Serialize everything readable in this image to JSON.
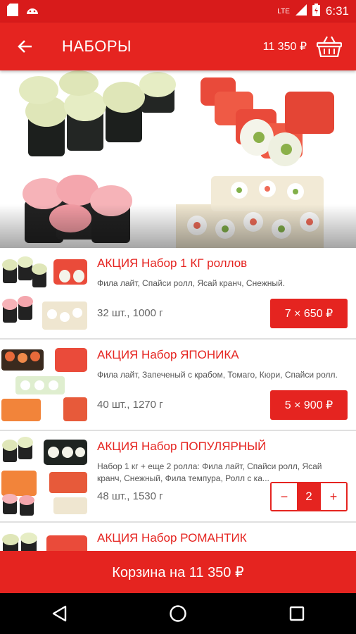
{
  "status_bar": {
    "network": "LTE",
    "time": "6:31"
  },
  "app_bar": {
    "title": "НАБОРЫ",
    "cart_total": "11 350 ₽"
  },
  "colors": {
    "accent": "#e52420",
    "status": "#d81b1b"
  },
  "items": [
    {
      "title": "АКЦИЯ Набор 1 КГ роллов",
      "description": "Фила лайт, Спайси ролл, Ясай кранч, Снежный.",
      "meta": "32 шт., 1000 г",
      "price_label": "7 × 650 ₽"
    },
    {
      "title": "АКЦИЯ Набор ЯПОНИКА",
      "description": "Фила лайт, Запеченый с крабом, Томаго, Кюри, Спайси ролл.",
      "meta": "40 шт., 1270 г",
      "price_label": "5 × 900 ₽"
    },
    {
      "title": "АКЦИЯ Набор ПОПУЛЯРНЫЙ",
      "description": "Набор 1 кг + еще 2 ролла: Фила лайт, Спайси ролл, Ясай кранч, Снежный, Фила темпура, Ролл с ка...",
      "meta": "48 шт., 1530 г",
      "quantity": "2",
      "minus": "−",
      "plus": "+"
    },
    {
      "title": "АКЦИЯ Набор РОМАНТИК"
    }
  ],
  "checkout": {
    "label": "Корзина на 11 350 ₽"
  }
}
